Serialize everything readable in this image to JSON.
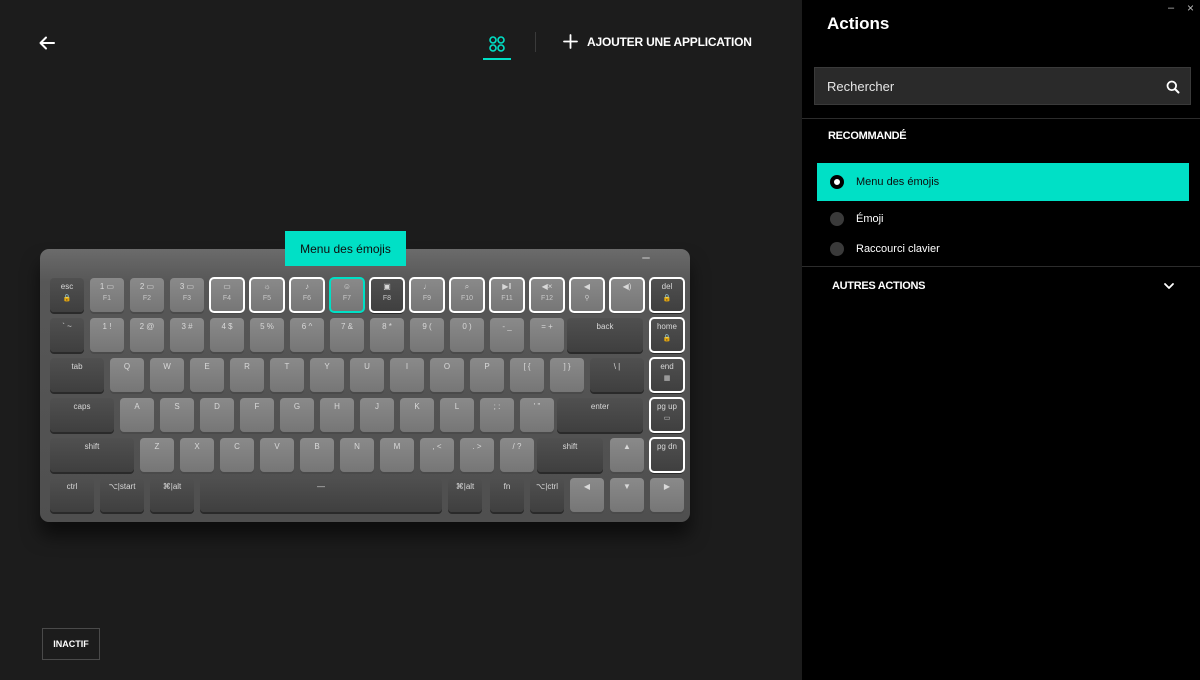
{
  "header": {
    "add_app_label": "AJOUTER UNE APPLICATION"
  },
  "status_button": "INACTIF",
  "tooltip": "Menu des émojis",
  "accent_color": "#00e0c6",
  "panel": {
    "title": "Actions",
    "window_controls": {
      "minimize": "–",
      "close": "×"
    },
    "search": {
      "placeholder": "Rechercher"
    },
    "recommended_title": "RECOMMANDÉ",
    "options": [
      {
        "label": "Menu des émojis",
        "selected": true
      },
      {
        "label": "Émoji",
        "selected": false
      },
      {
        "label": "Raccourci clavier",
        "selected": false
      }
    ],
    "more_actions_title": "AUTRES ACTIONS"
  },
  "keyboard": {
    "rows": [
      [
        {
          "top": "esc",
          "sub": "🔒",
          "shade": "dk"
        },
        {
          "top": "1 ▭",
          "sub": "F1",
          "shade": "lt"
        },
        {
          "top": "2 ▭",
          "sub": "F2",
          "shade": "lt"
        },
        {
          "top": "3 ▭",
          "sub": "F3",
          "shade": "lt"
        },
        {
          "top": "▭",
          "sub": "F4",
          "shade": "lt",
          "state": "hl"
        },
        {
          "top": "☼",
          "sub": "F5",
          "shade": "lt",
          "state": "hl"
        },
        {
          "top": "♪",
          "sub": "F6",
          "shade": "lt",
          "state": "hl"
        },
        {
          "top": "☺",
          "sub": "F7",
          "shade": "lt",
          "state": "ac"
        },
        {
          "top": "▣",
          "sub": "F8",
          "shade": "dk",
          "state": "hl"
        },
        {
          "top": "♩",
          "sub": "F9",
          "shade": "lt",
          "state": "hl"
        },
        {
          "top": "⌕",
          "sub": "F10",
          "shade": "lt",
          "state": "hl"
        },
        {
          "top": "▶‖",
          "sub": "F11",
          "shade": "lt",
          "state": "hl"
        },
        {
          "top": "◀×",
          "sub": "F12",
          "shade": "lt",
          "state": "hl"
        },
        {
          "top": "◀",
          "sub": "⚲",
          "shade": "lt",
          "state": "hl"
        },
        {
          "top": "◀)",
          "sub": "",
          "shade": "lt",
          "state": "hl"
        },
        {
          "top": "del",
          "sub": "🔒",
          "shade": "dk",
          "state": "hl"
        }
      ],
      [
        {
          "top": "` ~",
          "shade": "dk"
        },
        {
          "top": "1 !",
          "shade": "lt"
        },
        {
          "top": "2 @",
          "shade": "lt"
        },
        {
          "top": "3 #",
          "shade": "lt"
        },
        {
          "top": "4 $",
          "shade": "lt"
        },
        {
          "top": "5 %",
          "shade": "lt"
        },
        {
          "top": "6 ^",
          "shade": "lt"
        },
        {
          "top": "7 &",
          "shade": "lt"
        },
        {
          "top": "8 *",
          "shade": "lt"
        },
        {
          "top": "9 (",
          "shade": "lt"
        },
        {
          "top": "0 )",
          "shade": "lt"
        },
        {
          "top": "- _",
          "shade": "lt"
        },
        {
          "top": "= +",
          "shade": "lt"
        },
        {
          "top": "back",
          "shade": "dk"
        },
        {
          "top": "home",
          "sub": "🔒",
          "shade": "dk",
          "state": "hl"
        }
      ],
      [
        {
          "top": "tab",
          "shade": "dk"
        },
        {
          "top": "Q",
          "shade": "lt"
        },
        {
          "top": "W",
          "shade": "lt"
        },
        {
          "top": "E",
          "shade": "lt"
        },
        {
          "top": "R",
          "shade": "lt"
        },
        {
          "top": "T",
          "shade": "lt"
        },
        {
          "top": "Y",
          "shade": "lt"
        },
        {
          "top": "U",
          "shade": "lt"
        },
        {
          "top": "I",
          "shade": "lt"
        },
        {
          "top": "O",
          "shade": "lt"
        },
        {
          "top": "P",
          "shade": "lt"
        },
        {
          "top": "[ {",
          "shade": "lt"
        },
        {
          "top": "] }",
          "shade": "lt"
        },
        {
          "top": "\\ |",
          "shade": "dk"
        },
        {
          "top": "end",
          "sub": "▦",
          "shade": "dk",
          "state": "hl"
        }
      ],
      [
        {
          "top": "caps",
          "shade": "dk"
        },
        {
          "top": "A",
          "shade": "lt"
        },
        {
          "top": "S",
          "shade": "lt"
        },
        {
          "top": "D",
          "shade": "lt"
        },
        {
          "top": "F",
          "shade": "lt"
        },
        {
          "top": "G",
          "shade": "lt"
        },
        {
          "top": "H",
          "shade": "lt"
        },
        {
          "top": "J",
          "shade": "lt"
        },
        {
          "top": "K",
          "shade": "lt"
        },
        {
          "top": "L",
          "shade": "lt"
        },
        {
          "top": "; :",
          "shade": "lt"
        },
        {
          "top": "' \"",
          "shade": "lt"
        },
        {
          "top": "enter",
          "shade": "dk"
        },
        {
          "top": "pg up",
          "sub": "▭",
          "shade": "dk",
          "state": "hl"
        }
      ],
      [
        {
          "top": "shift",
          "shade": "dk"
        },
        {
          "top": "Z",
          "shade": "lt"
        },
        {
          "top": "X",
          "shade": "lt"
        },
        {
          "top": "C",
          "shade": "lt"
        },
        {
          "top": "V",
          "shade": "lt"
        },
        {
          "top": "B",
          "shade": "lt"
        },
        {
          "top": "N",
          "shade": "lt"
        },
        {
          "top": "M",
          "shade": "lt"
        },
        {
          "top": ", <",
          "shade": "lt"
        },
        {
          "top": ". >",
          "shade": "lt"
        },
        {
          "top": "/ ?",
          "shade": "lt"
        },
        {
          "top": "shift",
          "shade": "dk"
        },
        {
          "top": "▲",
          "shade": "lt"
        },
        {
          "top": "pg dn",
          "shade": "dk",
          "state": "hl"
        }
      ],
      [
        {
          "top": "ctrl",
          "shade": "dk"
        },
        {
          "top": "⌥|start",
          "shade": "dk"
        },
        {
          "top": "⌘|alt",
          "shade": "dk"
        },
        {
          "top": "—",
          "shade": "dk"
        },
        {
          "top": "⌘|alt",
          "shade": "dk"
        },
        {
          "top": "fn",
          "shade": "dk"
        },
        {
          "top": "⌥|ctrl",
          "shade": "dk"
        },
        {
          "top": "◀",
          "shade": "lt"
        },
        {
          "top": "▼",
          "shade": "lt"
        },
        {
          "top": "▶",
          "shade": "lt"
        }
      ]
    ]
  }
}
